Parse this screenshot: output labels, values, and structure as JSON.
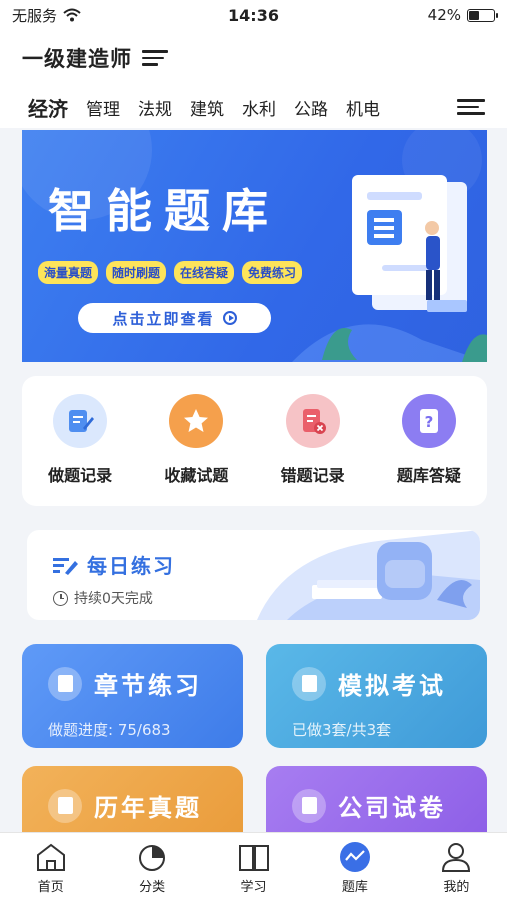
{
  "status_bar": {
    "carrier": "无服务",
    "time": "14:36",
    "battery": "42%",
    "battery_level": 0.42
  },
  "header": {
    "title": "一级建造师"
  },
  "tabs": [
    {
      "label": "经济",
      "active": true
    },
    {
      "label": "管理"
    },
    {
      "label": "法规"
    },
    {
      "label": "建筑"
    },
    {
      "label": "水利"
    },
    {
      "label": "公路"
    },
    {
      "label": "机电"
    }
  ],
  "banner": {
    "title": "智能题库",
    "pills": [
      "海量真题",
      "随时刷题",
      "在线答疑",
      "免费练习"
    ],
    "cta": "点击立即查看"
  },
  "quick_actions": [
    {
      "label": "做题记录",
      "icon": "edit-icon",
      "color": "#4f8ef0"
    },
    {
      "label": "收藏试题",
      "icon": "star-icon",
      "color": "#f08a3a"
    },
    {
      "label": "错题记录",
      "icon": "wrong-doc-icon",
      "color": "#ea5f6a"
    },
    {
      "label": "题库答疑",
      "icon": "question-doc-icon",
      "color": "#7b6ef0"
    }
  ],
  "daily": {
    "title": "每日练习",
    "subtitle": "持续0天完成"
  },
  "cards": [
    {
      "title": "章节练习",
      "subtitle": "做题进度: 75/683"
    },
    {
      "title": "模拟考试",
      "subtitle": "已做3套/共3套"
    },
    {
      "title": "历年真题",
      "subtitle": ""
    },
    {
      "title": "公司试卷",
      "subtitle": ""
    }
  ],
  "tabbar": [
    {
      "label": "首页",
      "icon": "home-icon"
    },
    {
      "label": "分类",
      "icon": "pie-icon"
    },
    {
      "label": "学习",
      "icon": "book-icon"
    },
    {
      "label": "题库",
      "icon": "chart-icon",
      "active": true
    },
    {
      "label": "我的",
      "icon": "user-icon"
    }
  ]
}
